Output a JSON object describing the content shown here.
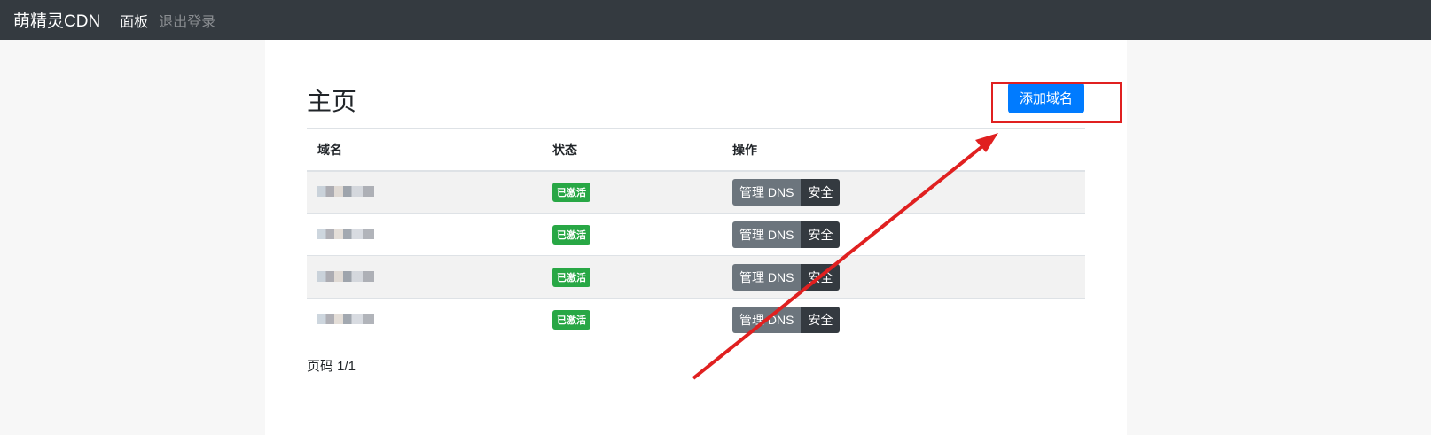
{
  "navbar": {
    "brand": "萌精灵CDN",
    "links": [
      "面板",
      "退出登录"
    ]
  },
  "main": {
    "title": "主页",
    "add_button": "添加域名",
    "table": {
      "headers": [
        "域名",
        "状态",
        "操作"
      ],
      "rows": [
        {
          "status": "已激活",
          "actions": [
            "管理 DNS",
            "安全"
          ]
        },
        {
          "status": "已激活",
          "actions": [
            "管理 DNS",
            "安全"
          ]
        },
        {
          "status": "已激活",
          "actions": [
            "管理 DNS",
            "安全"
          ]
        },
        {
          "status": "已激活",
          "actions": [
            "管理 DNS",
            "安全"
          ]
        }
      ]
    },
    "pagination": "页码 1/1"
  },
  "annotation": {
    "color": "#e02020"
  },
  "colors": {
    "primary": "#007bff",
    "success": "#28a745",
    "navbar": "#343a40"
  }
}
